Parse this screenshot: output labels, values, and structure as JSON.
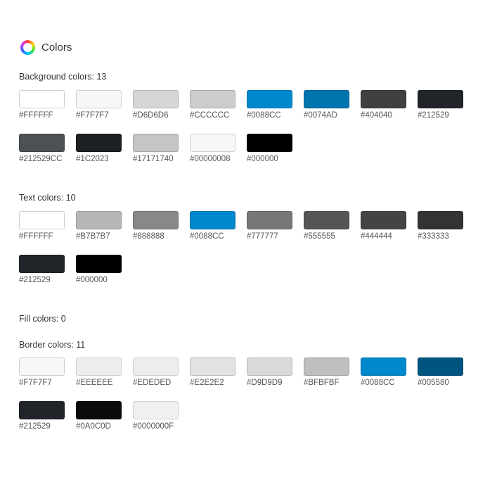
{
  "header": {
    "title": "Colors",
    "logo_icon": "color-wheel-icon"
  },
  "sections": {
    "background": {
      "label": "Background colors: 13",
      "colors": [
        "#FFFFFF",
        "#F7F7F7",
        "#D6D6D6",
        "#CCCCCC",
        "#0088CC",
        "#0074AD",
        "#404040",
        "#212529",
        "#212529CC",
        "#1C2023",
        "#17171740",
        "#00000008",
        "#000000"
      ]
    },
    "text": {
      "label": "Text colors: 10",
      "colors": [
        "#FFFFFF",
        "#B7B7B7",
        "#888888",
        "#0088CC",
        "#777777",
        "#555555",
        "#444444",
        "#333333",
        "#212529",
        "#000000"
      ]
    },
    "fill": {
      "label": "Fill colors: 0",
      "colors": []
    },
    "border": {
      "label": "Border colors: 11",
      "colors": [
        "#F7F7F7",
        "#EEEEEE",
        "#EDEDED",
        "#E2E2E2",
        "#D9D9D9",
        "#BFBFBF",
        "#0088CC",
        "#005580",
        "#212529",
        "#0A0C0D",
        "#0000000F"
      ]
    }
  }
}
